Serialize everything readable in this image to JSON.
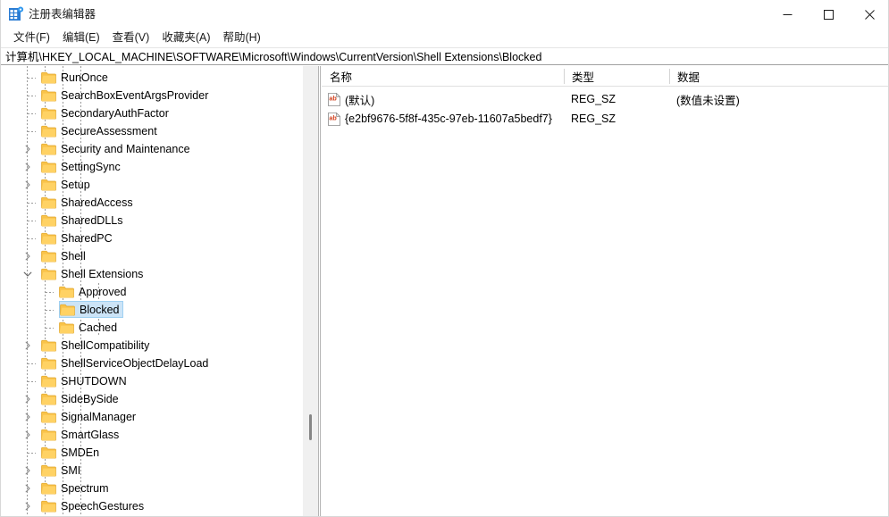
{
  "window": {
    "title": "注册表编辑器",
    "icon": "registry-editor-icon",
    "controls": {
      "minimize": "minimize-icon",
      "maximize": "maximize-icon",
      "close": "close-icon"
    }
  },
  "menubar": {
    "items": [
      {
        "label": "文件(F)"
      },
      {
        "label": "编辑(E)"
      },
      {
        "label": "查看(V)"
      },
      {
        "label": "收藏夹(A)"
      },
      {
        "label": "帮助(H)"
      }
    ]
  },
  "address": {
    "path": "计算机\\HKEY_LOCAL_MACHINE\\SOFTWARE\\Microsoft\\Windows\\CurrentVersion\\Shell Extensions\\Blocked"
  },
  "tree": {
    "items": [
      {
        "label": "RunOnce",
        "depth": 5,
        "expander": "none",
        "selected": false
      },
      {
        "label": "SearchBoxEventArgsProvider",
        "depth": 5,
        "expander": "none",
        "selected": false
      },
      {
        "label": "SecondaryAuthFactor",
        "depth": 5,
        "expander": "none",
        "selected": false
      },
      {
        "label": "SecureAssessment",
        "depth": 5,
        "expander": "none",
        "selected": false
      },
      {
        "label": "Security and Maintenance",
        "depth": 5,
        "expander": "collapsed",
        "selected": false
      },
      {
        "label": "SettingSync",
        "depth": 5,
        "expander": "collapsed",
        "selected": false
      },
      {
        "label": "Setup",
        "depth": 5,
        "expander": "collapsed",
        "selected": false
      },
      {
        "label": "SharedAccess",
        "depth": 5,
        "expander": "none",
        "selected": false
      },
      {
        "label": "SharedDLLs",
        "depth": 5,
        "expander": "none",
        "selected": false
      },
      {
        "label": "SharedPC",
        "depth": 5,
        "expander": "none",
        "selected": false
      },
      {
        "label": "Shell",
        "depth": 5,
        "expander": "collapsed",
        "selected": false
      },
      {
        "label": "Shell Extensions",
        "depth": 5,
        "expander": "expanded",
        "selected": false
      },
      {
        "label": "Approved",
        "depth": 6,
        "expander": "none",
        "selected": false
      },
      {
        "label": "Blocked",
        "depth": 6,
        "expander": "none",
        "selected": true
      },
      {
        "label": "Cached",
        "depth": 6,
        "expander": "none",
        "selected": false
      },
      {
        "label": "ShellCompatibility",
        "depth": 5,
        "expander": "collapsed",
        "selected": false
      },
      {
        "label": "ShellServiceObjectDelayLoad",
        "depth": 5,
        "expander": "none",
        "selected": false
      },
      {
        "label": "SHUTDOWN",
        "depth": 5,
        "expander": "none",
        "selected": false
      },
      {
        "label": "SideBySide",
        "depth": 5,
        "expander": "collapsed",
        "selected": false
      },
      {
        "label": "SignalManager",
        "depth": 5,
        "expander": "collapsed",
        "selected": false
      },
      {
        "label": "SmartGlass",
        "depth": 5,
        "expander": "collapsed",
        "selected": false
      },
      {
        "label": "SMDEn",
        "depth": 5,
        "expander": "none",
        "selected": false
      },
      {
        "label": "SMI",
        "depth": 5,
        "expander": "collapsed",
        "selected": false
      },
      {
        "label": "Spectrum",
        "depth": 5,
        "expander": "collapsed",
        "selected": false
      },
      {
        "label": "SpeechGestures",
        "depth": 5,
        "expander": "collapsed",
        "selected": false
      }
    ]
  },
  "list": {
    "columns": [
      {
        "label": "名称"
      },
      {
        "label": "类型"
      },
      {
        "label": "数据"
      }
    ],
    "rows": [
      {
        "icon": "string-value-icon",
        "name": "(默认)",
        "type": "REG_SZ",
        "data": "(数值未设置)"
      },
      {
        "icon": "string-value-icon",
        "name": "{e2bf9676-5f8f-435c-97eb-11607a5bedf7}",
        "type": "REG_SZ",
        "data": ""
      }
    ]
  },
  "colors": {
    "selection": "#cce4f7",
    "selection_border": "#9fd0f2",
    "folder": "#ffc societe"
  }
}
